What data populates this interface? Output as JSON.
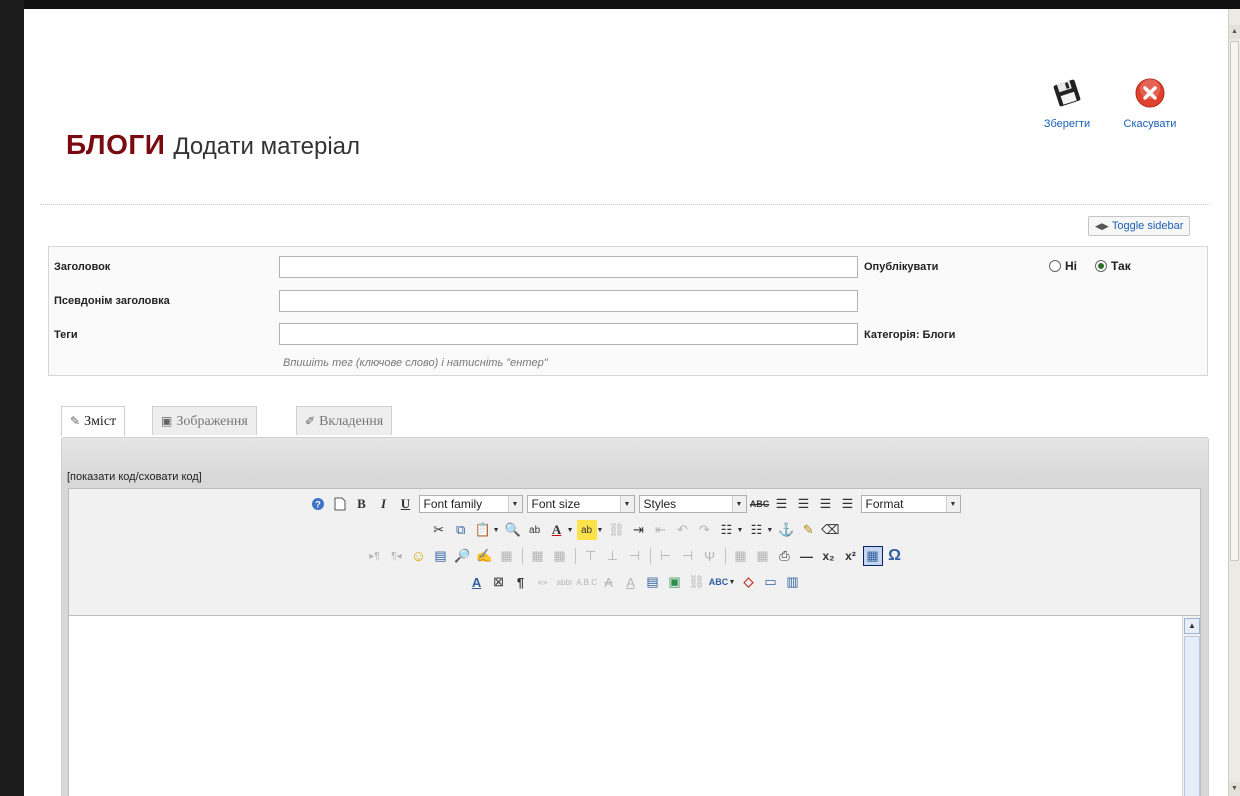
{
  "toolbar": {
    "save_label": "Зберегти",
    "cancel_label": "Скасувати"
  },
  "header": {
    "section_title": "БЛОГИ",
    "page_title": "Додати матеріал"
  },
  "sidebar_toggle": {
    "label": "Toggle sidebar"
  },
  "form": {
    "title_label": "Заголовок",
    "title_value": "",
    "alias_label": "Псевдонім заголовка",
    "alias_value": "",
    "tags_label": "Теги",
    "tags_value": "",
    "tags_hint": "Впишіть тег (ключове слово) і натисніть \"ентер\"",
    "publish_label": "Опублікувати",
    "publish_options": [
      "Ні",
      "Так"
    ],
    "publish_selected": "Так",
    "category_label": "Категорія: Блоги"
  },
  "tabs": [
    {
      "label": "Зміст",
      "icon": "edit-icon",
      "active": true
    },
    {
      "label": "Зображення",
      "icon": "image-icon",
      "active": false
    },
    {
      "label": "Вкладення",
      "icon": "paperclip-icon",
      "active": false
    }
  ],
  "editor": {
    "code_toggle": "[показати код/сховати код]",
    "font_family": "Font family",
    "font_size": "Font size",
    "styles": "Styles",
    "format": "Format",
    "content": ""
  },
  "colors": {
    "section_title": "#7a0a0f",
    "link": "#1a5fb4",
    "cancel_icon": "#e0412f"
  }
}
